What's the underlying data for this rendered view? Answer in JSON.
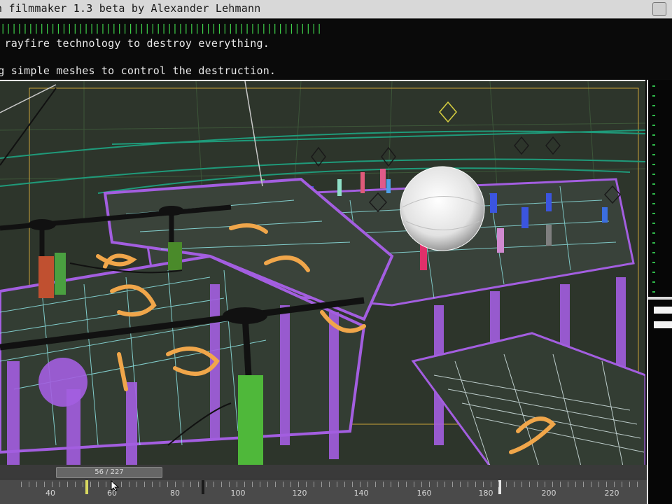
{
  "window": {
    "title": "n filmmaker 1.3 beta by Alexander Lehmann"
  },
  "console": {
    "progress_bars": "||||||||||||||||||||||||||||||||||||||||||||||||||||||||||",
    "lines": [
      "g rayfire technology to destroy everything.",
      "ng simple meshes to control the destruction."
    ]
  },
  "timeline": {
    "frame_counter": "56 / 227",
    "tick_labels": [
      "40",
      "60",
      "80",
      "100",
      "120",
      "140",
      "160",
      "180",
      "200",
      "220"
    ]
  },
  "colors": {
    "viewport_bg": "#2d352b",
    "structure": "#a35ee0",
    "wire_cyan": "#8fe6e6",
    "orange_path": "#f0a64a",
    "grid_green": "#1f9a7a",
    "console_green": "#3fd14a"
  }
}
